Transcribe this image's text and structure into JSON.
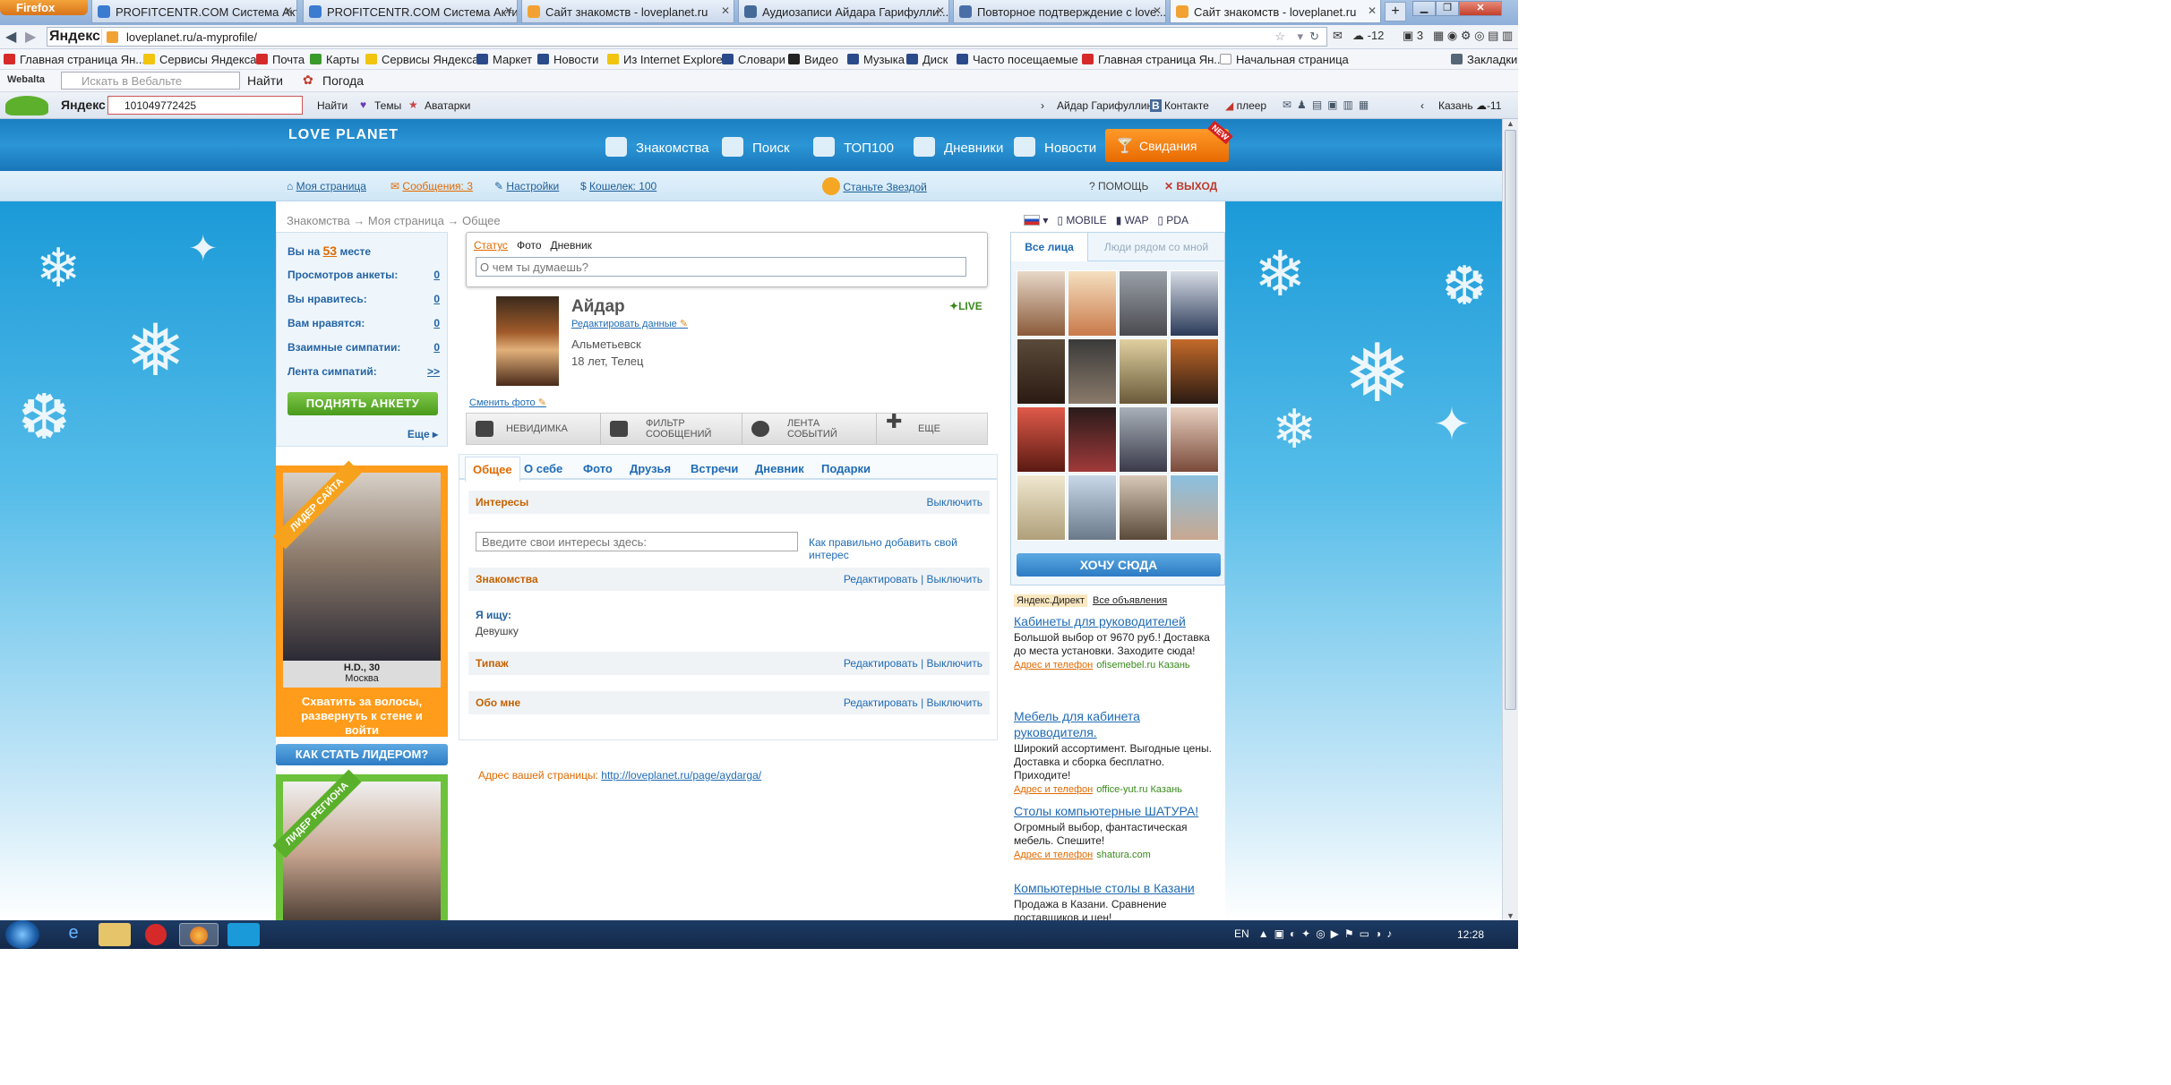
{
  "browser": {
    "menu_button": "Firefox",
    "tabs": [
      {
        "label": "PROFITCENTR.COM Система Акти...",
        "active": false
      },
      {
        "label": "PROFITCENTR.COM Система Акти...",
        "active": false
      },
      {
        "label": "Сайт знакомств - loveplanet.ru",
        "active": false
      },
      {
        "label": "Аудиозаписи Айдара Гарифулли...",
        "active": false
      },
      {
        "label": "Повторное подтверждение с love...",
        "active": false
      },
      {
        "label": "Сайт знакомств - loveplanet.ru",
        "active": true
      }
    ],
    "new_tab": "+",
    "yandex_badge": "Яндекс",
    "url": "loveplanet.ru/a-myprofile/",
    "weather_temp": "-12",
    "mail_count": "3"
  },
  "bookmarks": [
    "Главная страница Ян...",
    "Сервисы Яндекса",
    "Почта",
    "Карты",
    "Сервисы Яндекса",
    "Маркет",
    "Новости",
    "Из Internet Explorer",
    "Словари",
    "Видео",
    "Музыка",
    "Диск",
    "Часто посещаемые",
    "Главная страница Ян...",
    "Начальная страница"
  ],
  "bookmarks_right": "Закладки",
  "webalta": {
    "logo": "Webalta",
    "search_placeholder": "Искать в Вебальте",
    "find": "Найти",
    "weather": "Погода"
  },
  "yandexbar": {
    "logo": "Яндекс",
    "query": "101049772425",
    "find": "Найти",
    "themes": "Темы",
    "avatars": "Аватарки",
    "user": "Айдар Гарифуллин",
    "vk": "Контакте",
    "player": "плеер",
    "city": "Казань",
    "temp": "-11"
  },
  "site": {
    "logo": "LOVE PLANET",
    "nav": [
      "Знакомства",
      "Поиск",
      "ТОП100",
      "Дневники",
      "Новости"
    ],
    "nav_special": "Свидания",
    "new_badge": "NEW",
    "subnav": {
      "my_page": "Моя страница",
      "messages": "Сообщения: 3",
      "settings": "Настройки",
      "wallet": "Кошелек: 100",
      "star": "Станьте Звездой",
      "help": "? ПОМОЩЬ",
      "exit": "✕ ВЫХОД"
    },
    "breadcrumb": "Знакомства → Моя страница → Общее",
    "lang": {
      "mobile": "MOBILE",
      "wap": "WAP",
      "pda": "PDA"
    }
  },
  "stats": {
    "rank_pre": "Вы на",
    "rank": "53",
    "rank_post": "месте",
    "rows": [
      {
        "label": "Просмотров анкеты:",
        "value": "0"
      },
      {
        "label": "Вы нравитесь:",
        "value": "0"
      },
      {
        "label": "Вам нравятся:",
        "value": "0"
      },
      {
        "label": "Взаимные симпатии:",
        "value": "0"
      },
      {
        "label": "Лента симпатий:",
        "value": ">>"
      }
    ],
    "raise_button": "ПОДНЯТЬ АНКЕТУ",
    "more": "Еще ▸"
  },
  "leader": {
    "ribbon": "ЛИДЕР САЙТА",
    "name": "H.D., 30",
    "city": "Москва",
    "text": "Схватить за волосы, развернуть к стене и войти",
    "how_button": "КАК СТАТЬ ЛИДЕРОМ?",
    "ribbon2": "ЛИДЕР РЕГИОНА"
  },
  "status_box": {
    "tabs": [
      "Статус",
      "Фото",
      "Дневник"
    ],
    "placeholder": "О чем ты думаешь?"
  },
  "profile": {
    "name": "Айдар",
    "edit": "Редактировать данные",
    "city": "Альметьевск",
    "age": "18 лет, Телец",
    "live": "LIVE",
    "change_photo": "Сменить фото"
  },
  "toolbar": [
    {
      "label": "НЕВИДИМКА"
    },
    {
      "label": "ФИЛЬТР СООБЩЕНИЙ"
    },
    {
      "label": "ЛЕНТА СОБЫТИЙ"
    },
    {
      "label": "ЕЩЕ"
    }
  ],
  "profile_tabs": [
    "Общее",
    "О себе",
    "Фото",
    "Друзья",
    "Встречи",
    "Дневник",
    "Подарки"
  ],
  "sections": {
    "interests": {
      "title": "Интересы",
      "action": "Выключить"
    },
    "interests_placeholder": "Введите свои интересы здесь:",
    "how_add": "Как правильно добавить свой интерес",
    "dating": {
      "title": "Знакомства",
      "action": "Редактировать | Выключить"
    },
    "i_seek_label": "Я ищу:",
    "i_seek_value": "Девушку",
    "type": {
      "title": "Типаж",
      "action": "Редактировать | Выключить"
    },
    "about": {
      "title": "Обо мне",
      "action": "Редактировать | Выключить"
    }
  },
  "page_address": {
    "label": "Адрес вашей страницы:",
    "url": "http://loveplanet.ru/page/aydarga/"
  },
  "faces": {
    "tab_all": "Все лица",
    "tab_near": "Люди рядом со мной",
    "want_button": "ХОЧУ СЮДА"
  },
  "ads": {
    "header": "Яндекс.Директ",
    "all": "Все объявления",
    "items": [
      {
        "title": "Кабинеты для руководителей",
        "desc": "Большой выбор от 9670 руб.! Доставка до места установки. Заходите сюда!",
        "link": "Адрес и телефон",
        "domain": "ofisemebel.ru Казань"
      },
      {
        "title": "Мебель для кабинета руководителя.",
        "desc": "Широкий ассортимент. Выгодные цены. Доставка и сборка бесплатно. Приходите!",
        "link": "Адрес и телефон",
        "domain": "office-yut.ru Казань"
      },
      {
        "title": "Столы компьютерные ШАТУРА!",
        "desc": "Огромный выбор, фантастическая мебель. Спешите!",
        "link": "Адрес и телефон",
        "domain": "shatura.com"
      },
      {
        "title": "Компьютерные столы в Казани",
        "desc": "Продажа в Казани. Сравнение поставщиков и цен!",
        "link": "",
        "domain": ""
      }
    ]
  },
  "taskbar": {
    "lang": "EN",
    "clock": "12:28"
  }
}
